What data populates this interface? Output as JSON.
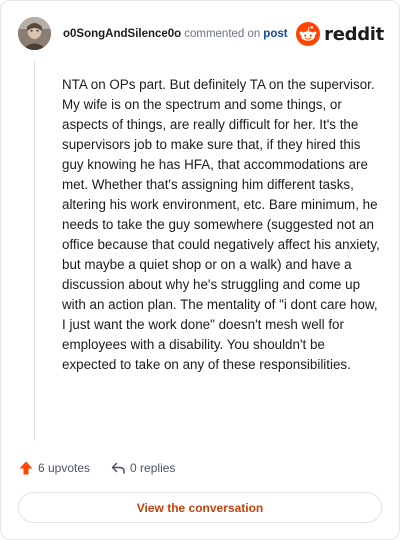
{
  "header": {
    "username": "o0SongAndSilence0o",
    "action_text": "commented on",
    "post_link": "post",
    "brand": "reddit"
  },
  "comment": {
    "body": "NTA on OPs part. But definitely TA on the supervisor. My wife is on the spectrum and some things, or aspects of things, are really difficult for her. It's the supervisors job to make sure that, if they hired this guy knowing he has HFA, that accommodations are met. Whether that's assigning him different tasks, altering his work environment, etc. Bare minimum, he needs to take the guy somewhere (suggested not an office because that could negatively affect his anxiety, but maybe a quiet shop or on a walk) and have a discussion about why he's struggling and come up with an action plan. The mentality of \"i dont care how, I just want the work done\" doesn't mesh well for employees with a disability. You shouldn't be expected to take on any of these responsibilities."
  },
  "actions": {
    "upvotes": "6 upvotes",
    "replies": "0 replies"
  },
  "cta": {
    "label": "View the conversation"
  },
  "icons": {
    "avatar": "user-avatar",
    "brand": "reddit-snoo-icon",
    "upvote": "upvote-arrow-icon",
    "reply": "reply-arrow-icon"
  },
  "colors": {
    "brand_orange": "#ff4500",
    "link_blue": "#0f4c9a",
    "cta_text": "#c2410c"
  }
}
